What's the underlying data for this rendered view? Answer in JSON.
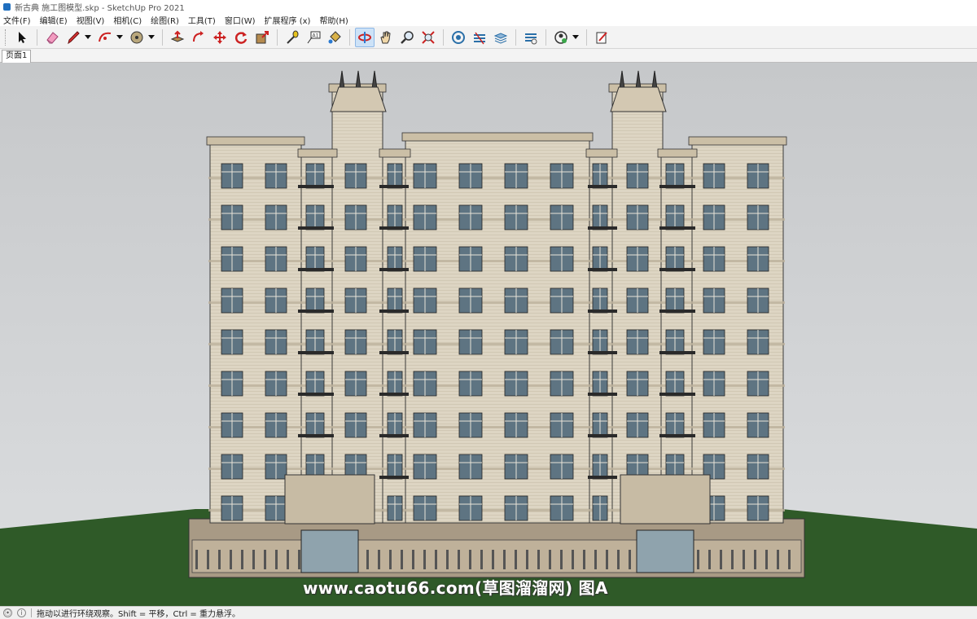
{
  "window": {
    "title": "新古典 施工图模型.skp - SketchUp Pro 2021"
  },
  "menu": [
    "文件(F)",
    "编辑(E)",
    "视图(V)",
    "相机(C)",
    "绘图(R)",
    "工具(T)",
    "窗口(W)",
    "扩展程序 (x)",
    "帮助(H)"
  ],
  "toolbar": {
    "tools": [
      "select",
      "eraser",
      "line",
      "arc",
      "shape",
      "push-pull",
      "move",
      "rotate",
      "scale",
      "offset",
      "tape-measure",
      "text",
      "paint-bucket",
      "orbit",
      "pan",
      "zoom",
      "zoom-extents",
      "3d-warehouse",
      "extension-warehouse",
      "layout",
      "styles",
      "account",
      "scenes"
    ],
    "active_tool": "orbit"
  },
  "scene_tab": {
    "label": "页面1"
  },
  "watermark": {
    "text": "www.caotu66.com(草图溜溜网) 图A"
  },
  "status": {
    "message": "拖动以进行环绕观察。Shift = 平移，Ctrl = 重力悬浮。"
  },
  "colors": {
    "sky": "#c9cbcd",
    "ground": "#2f5a28",
    "facade": "#ddd5c3",
    "frame": "#c8bda6",
    "window": "#5e7482",
    "accent_active": "#cde2f7"
  }
}
